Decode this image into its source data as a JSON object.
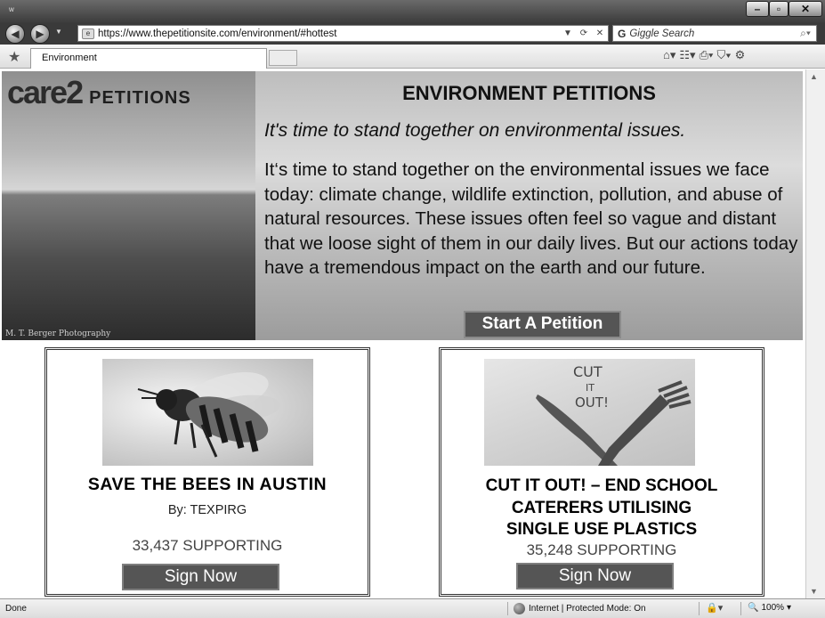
{
  "browser": {
    "title_glyph": "w",
    "window_buttons": {
      "minimize": "–",
      "maximize": "▫",
      "close": "✕"
    },
    "address": "https://www.thepetitionsite.com/environment/#hottest",
    "search_placeholder": "Giggle Search",
    "search_logo": "G",
    "tab_label": "Environment",
    "icons": [
      "back-icon",
      "forward-icon",
      "home-icon",
      "feeds-icon",
      "print-icon",
      "safety-icon",
      "tools-icon"
    ]
  },
  "hero": {
    "logo_text": "care2",
    "logo_sub": "PETITIONS",
    "photo_credit": "M. T. Berger Photography",
    "title": "ENVIRONMENT PETITIONS",
    "tagline": "It's time to stand together on environmental issues.",
    "body": "It‘s time to stand together on the environmental issues we face today: climate change, wildlife extinction, pollution, and abuse of natural resources. These issues often feel so vague and distant that we loose sight of them in our daily lives. But our actions today have a tremendous impact on the earth and our future.",
    "start_button": "Start A Petition"
  },
  "petitions": [
    {
      "title": "SAVE THE BEES IN AUSTIN",
      "author": "By: TEXPIRG",
      "supporters": "33,437  SUPPORTING",
      "button": "Sign Now"
    },
    {
      "title_lines": [
        "CUT IT OUT! – END SCHOOL",
        "CATERERS UTILISING",
        "SINGLE USE PLASTICS"
      ],
      "image_text": [
        "CUT",
        "IT",
        "OUT!"
      ],
      "supporters": "35,248  SUPPORTING",
      "button": "Sign Now"
    }
  ],
  "status": {
    "left": "Done",
    "zone": "Internet | Protected Mode: On",
    "zoom": "100%"
  }
}
